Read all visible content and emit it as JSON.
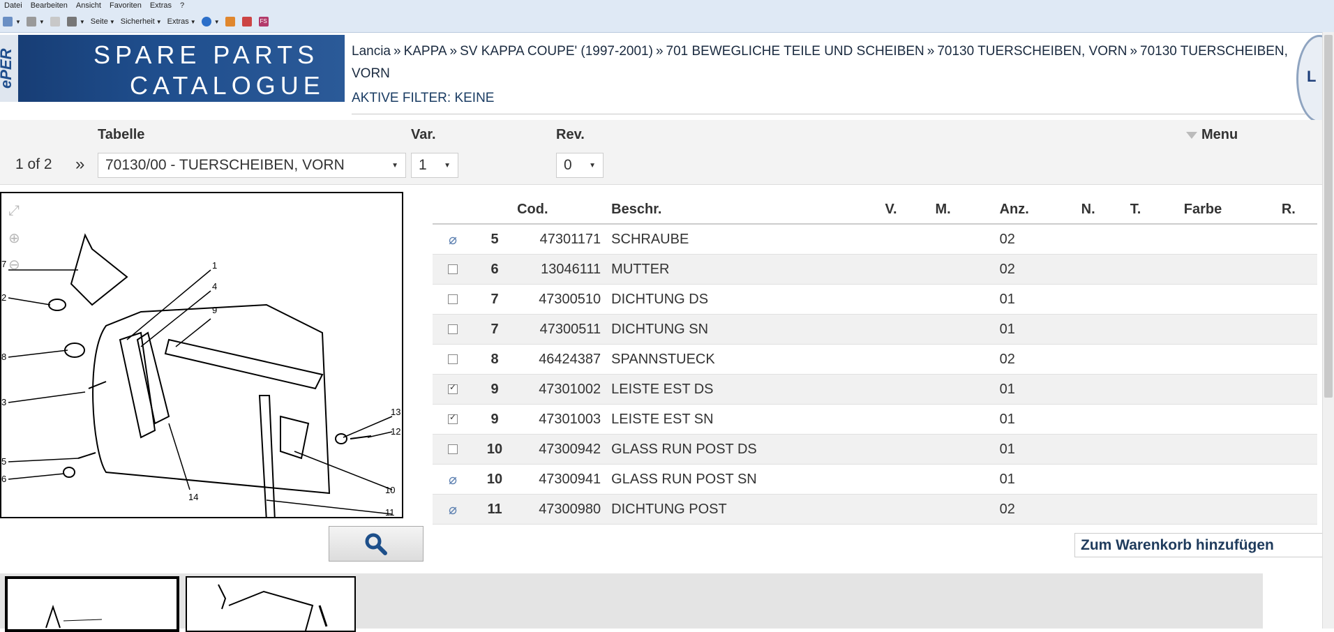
{
  "menubar": [
    "Datei",
    "Bearbeiten",
    "Ansicht",
    "Favoriten",
    "Extras",
    "?"
  ],
  "toolbar": {
    "seite": "Seite",
    "sicherheit": "Sicherheit",
    "extras": "Extras",
    "fs": "FS"
  },
  "logo": {
    "line1": "SPARE PARTS",
    "line2": "CATALOGUE",
    "side": "ePER"
  },
  "breadcrumb": [
    "Lancia",
    "KAPPA",
    "SV KAPPA COUPE' (1997-2001)",
    "701 BEWEGLICHE TEILE UND SCHEIBEN",
    "70130 TUERSCHEIBEN, VORN",
    "70130 TUERSCHEIBEN, VORN"
  ],
  "filter_text": "AKTIVE FILTER: KEINE",
  "brand_badge": "L",
  "labels": {
    "tabelle": "Tabelle",
    "var": "Var.",
    "rev": "Rev.",
    "menu": "Menu"
  },
  "pager": {
    "text": "1 of 2",
    "next": "»"
  },
  "selects": {
    "tabelle": "70130/00 - TUERSCHEIBEN, VORN",
    "var": "1",
    "rev": "0"
  },
  "table": {
    "headers": [
      "",
      "",
      "Cod.",
      "Beschr.",
      "V.",
      "M.",
      "Anz.",
      "N.",
      "T.",
      "Farbe",
      "R."
    ],
    "rows": [
      {
        "check": "none",
        "pos": "5",
        "cod": "47301171",
        "desc": "SCHRAUBE",
        "anz": "02"
      },
      {
        "check": "off",
        "pos": "6",
        "cod": "13046111",
        "desc": "MUTTER",
        "anz": "02"
      },
      {
        "check": "off",
        "pos": "7",
        "cod": "47300510",
        "desc": "DICHTUNG DS",
        "anz": "01"
      },
      {
        "check": "off",
        "pos": "7",
        "cod": "47300511",
        "desc": "DICHTUNG SN",
        "anz": "01"
      },
      {
        "check": "off",
        "pos": "8",
        "cod": "46424387",
        "desc": "SPANNSTUECK",
        "anz": "02"
      },
      {
        "check": "on",
        "pos": "9",
        "cod": "47301002",
        "desc": "LEISTE EST DS",
        "anz": "01"
      },
      {
        "check": "on",
        "pos": "9",
        "cod": "47301003",
        "desc": "LEISTE EST SN",
        "anz": "01"
      },
      {
        "check": "off",
        "pos": "10",
        "cod": "47300942",
        "desc": "GLASS RUN POST DS",
        "anz": "01"
      },
      {
        "check": "none",
        "pos": "10",
        "cod": "47300941",
        "desc": "GLASS RUN POST SN",
        "anz": "01"
      },
      {
        "check": "none",
        "pos": "11",
        "cod": "47300980",
        "desc": "DICHTUNG POST",
        "anz": "02"
      }
    ]
  },
  "drawing_callouts": [
    "1",
    "4",
    "9",
    "7",
    "2",
    "8",
    "3",
    "5",
    "6",
    "13",
    "12",
    "10",
    "11",
    "14"
  ],
  "cart_button": "Zum Warenkorb hinzufügen",
  "colors": {
    "logo_bg": "#1f4e8d",
    "toolbar_bg": "#dfe9f5",
    "checkbox_na": "#5b7fb0"
  }
}
